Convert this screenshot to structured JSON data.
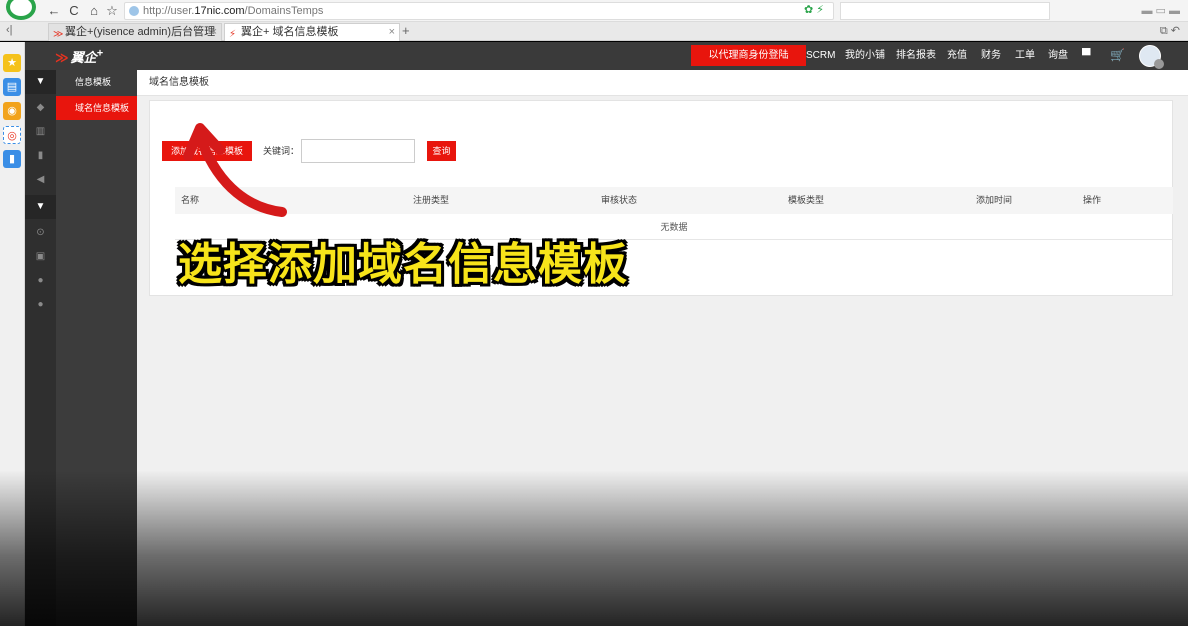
{
  "browser": {
    "url_prefix": "http://user.",
    "url_host": "17nic.com",
    "url_path": "/DomainsTemps",
    "tabs": [
      {
        "label": "翼企+(yisence admin)后台管理",
        "close": "×"
      },
      {
        "label": "翼企+ 域名信息模板",
        "close": "×"
      }
    ],
    "new_tab": "+",
    "nav": {
      "back": "←",
      "reload": "C",
      "home": "⌂",
      "star": "☆"
    }
  },
  "header": {
    "brand": "翼企",
    "brand_sup": "+",
    "agent_button": "以代理商身份登陆",
    "nav": [
      "SCRM",
      "我的小铺",
      "排名报表",
      "充值",
      "财务",
      "工单",
      "询盘"
    ]
  },
  "sidebar": {
    "section_title": "信息模板",
    "active_item": "域名信息模板"
  },
  "main": {
    "page_title": "域名信息模板",
    "add_button": "添加域名信息模板",
    "keyword_label": "关键词：",
    "keyword_value": "",
    "query_button": "查询",
    "table": {
      "columns": [
        "名称",
        "注册类型",
        "审核状态",
        "模板类型",
        "添加时间",
        "操作"
      ],
      "empty_text": "无数据"
    }
  },
  "overlay": {
    "caption": "选择添加域名信息模板",
    "arrow_color": "#d51a1a",
    "caption_color": "#f7e41a"
  },
  "colors": {
    "accent_red": "#e8150d",
    "header_dark": "#3a3a3a"
  }
}
